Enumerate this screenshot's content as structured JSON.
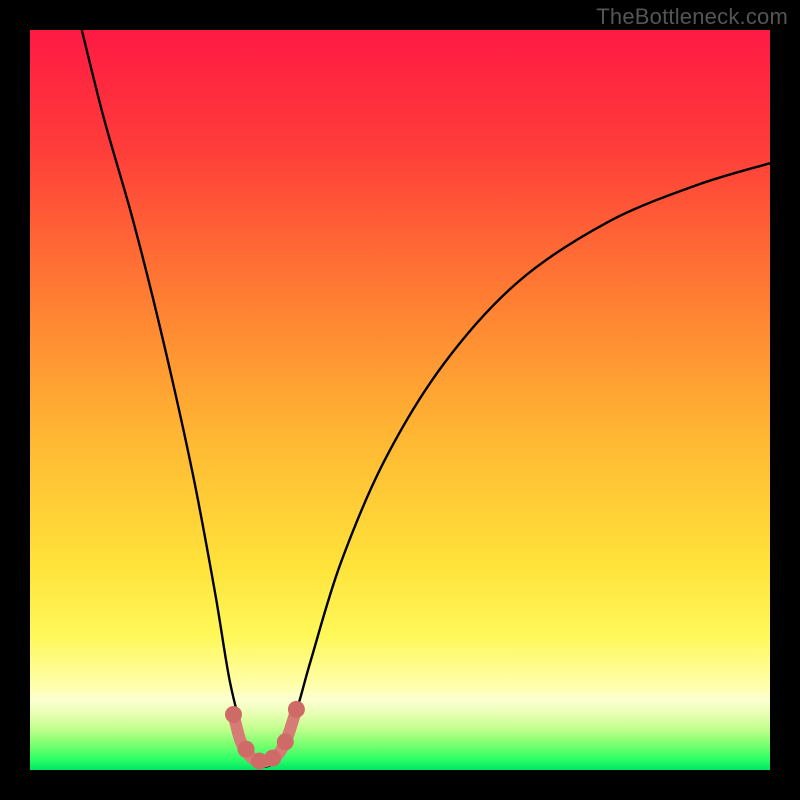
{
  "watermark": "TheBottleneck.com",
  "chart_data": {
    "type": "line",
    "title": "",
    "xlabel": "",
    "ylabel": "",
    "xlim": [
      0,
      100
    ],
    "ylim": [
      0,
      100
    ],
    "grid": false,
    "series": [
      {
        "name": "bottleneck-curve",
        "x": [
          7,
          10,
          14,
          18,
          22,
          25,
          27,
          29,
          30,
          31,
          32,
          33,
          34,
          36,
          38,
          42,
          48,
          56,
          66,
          78,
          90,
          100
        ],
        "y": [
          100,
          88,
          74,
          58,
          40,
          24,
          12,
          4,
          1,
          0.5,
          0.5,
          1,
          3,
          8,
          15,
          28,
          42,
          55,
          66,
          74,
          79,
          82
        ],
        "color": "#000000"
      },
      {
        "name": "marker-arc",
        "x": [
          27.5,
          28.5,
          29.8,
          31.0,
          32.2,
          33.6,
          34.8,
          36.0
        ],
        "y": [
          7.5,
          3.8,
          1.8,
          1.2,
          1.3,
          2.2,
          4.5,
          8.2
        ],
        "color": "#d77b77"
      }
    ],
    "markers": [
      {
        "x": 27.5,
        "y": 7.5
      },
      {
        "x": 29.2,
        "y": 2.8
      },
      {
        "x": 31.0,
        "y": 1.2
      },
      {
        "x": 32.8,
        "y": 1.6
      },
      {
        "x": 34.5,
        "y": 3.8
      },
      {
        "x": 36.0,
        "y": 8.2
      }
    ],
    "background_gradient": {
      "stops": [
        {
          "pos": 0.0,
          "color": "#ff1a44"
        },
        {
          "pos": 0.15,
          "color": "#ff3a3a"
        },
        {
          "pos": 0.35,
          "color": "#ff7a33"
        },
        {
          "pos": 0.55,
          "color": "#ffb733"
        },
        {
          "pos": 0.72,
          "color": "#ffe23a"
        },
        {
          "pos": 0.82,
          "color": "#fff85a"
        },
        {
          "pos": 0.885,
          "color": "#ffffaa"
        },
        {
          "pos": 0.905,
          "color": "#fdffd2"
        },
        {
          "pos": 0.925,
          "color": "#e6ffb0"
        },
        {
          "pos": 0.945,
          "color": "#c0ff8c"
        },
        {
          "pos": 0.965,
          "color": "#7dff70"
        },
        {
          "pos": 0.985,
          "color": "#2eff66"
        },
        {
          "pos": 1.0,
          "color": "#00e765"
        }
      ]
    }
  }
}
